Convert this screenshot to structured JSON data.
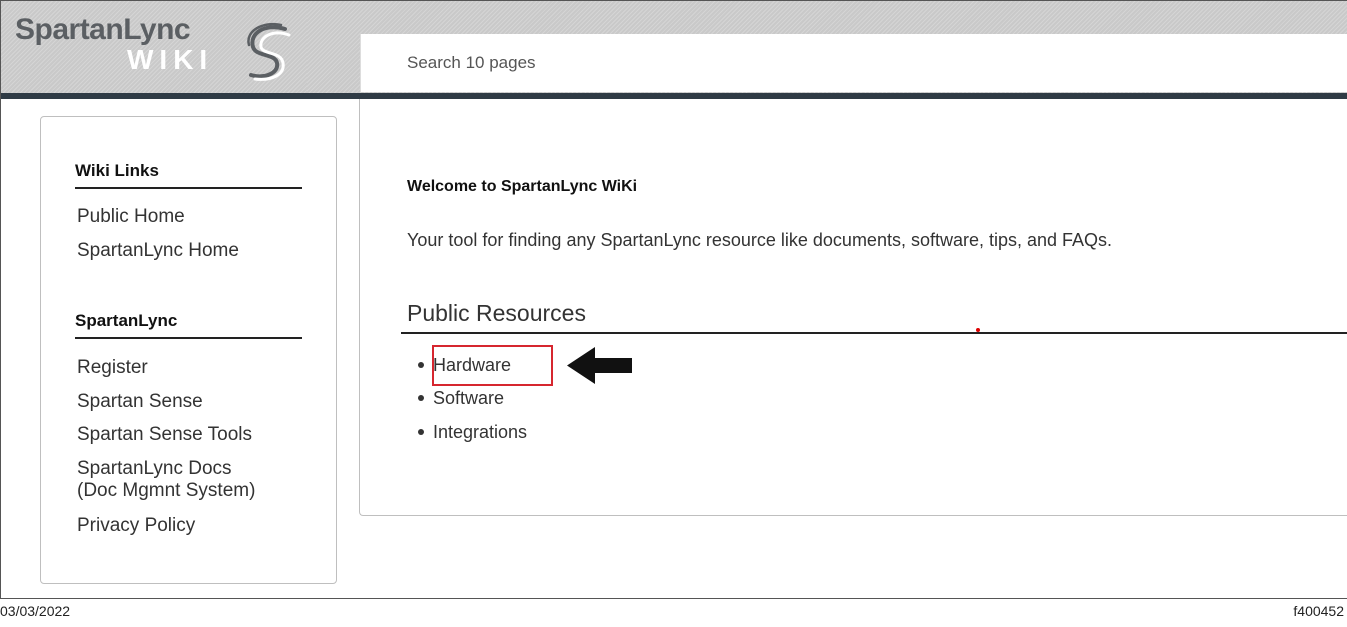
{
  "header": {
    "logo_main": "SpartanLync",
    "logo_sub": "WIKI",
    "search_placeholder": "Search 10 pages"
  },
  "sidebar": {
    "sections": [
      {
        "heading": "Wiki Links",
        "links": [
          "Public Home",
          "SpartanLync Home"
        ]
      },
      {
        "heading": "SpartanLync",
        "links": [
          "Register",
          "Spartan Sense",
          "Spartan Sense Tools",
          "SpartanLync Docs",
          "(Doc Mgmnt System)",
          "Privacy Policy"
        ]
      }
    ]
  },
  "main": {
    "welcome_title": "Welcome to SpartanLync WiKi",
    "welcome_desc": "Your tool for finding any SpartanLync resource like documents, software, tips, and FAQs.",
    "section_title": "Public Resources",
    "resources": [
      "Hardware",
      "Software",
      "Integrations"
    ],
    "highlight_color": "#d6262f"
  },
  "footer": {
    "date": "03/03/2022",
    "figure_id": "f400452"
  }
}
